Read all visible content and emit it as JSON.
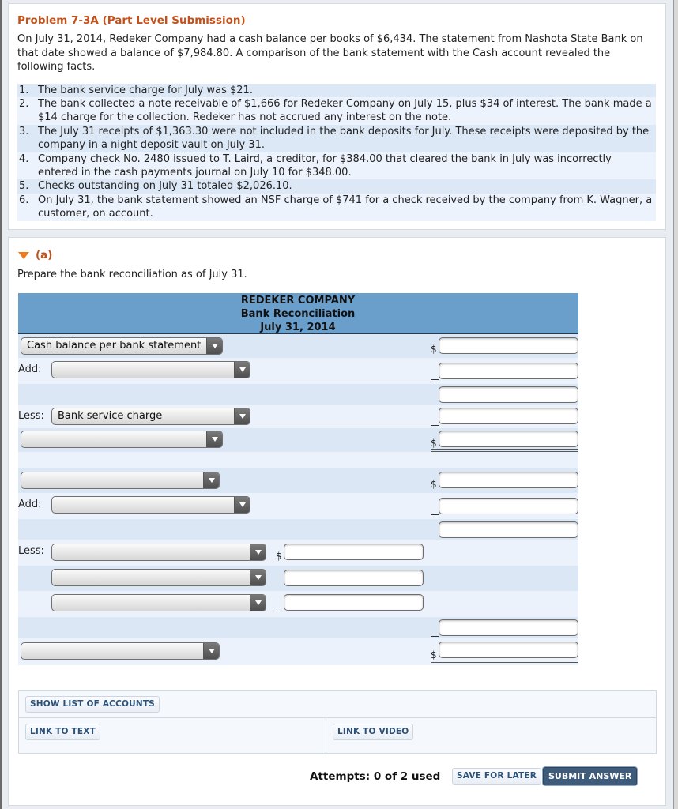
{
  "problem": {
    "title": "Problem 7-3A (Part Level Submission)",
    "intro": "On July 31, 2014, Redeker Company had a cash balance per books of $6,434. The statement from Nashota State Bank on that date showed a balance of $7,984.80. A comparison of the bank statement with the Cash account revealed the following facts.",
    "facts": [
      {
        "num": "1.",
        "text": "The bank service charge for July was $21."
      },
      {
        "num": "2.",
        "text": "The bank collected a note receivable of $1,666 for Redeker Company on July 15, plus $34 of interest. The bank made a $14 charge for the collection. Redeker has not accrued any interest on the note."
      },
      {
        "num": "3.",
        "text": "The July 31 receipts of $1,363.30 were not included in the bank deposits for July. These receipts were deposited by the company in a night deposit vault on July 31."
      },
      {
        "num": "4.",
        "text": "Company check No. 2480 issued to T. Laird, a creditor, for $384.00 that cleared the bank in July was incorrectly entered in the cash payments journal on July 10 for $348.00."
      },
      {
        "num": "5.",
        "text": "Checks outstanding on July 31 totaled $2,026.10."
      },
      {
        "num": "6.",
        "text": "On July 31, the bank statement showed an NSF charge of $741 for a check received by the company from K. Wagner, a customer, on account."
      }
    ]
  },
  "part_a": {
    "label": "(a)",
    "instruction": "Prepare the bank reconciliation as of July 31.",
    "header": {
      "company": "REDEKER COMPANY",
      "statement": "Bank Reconciliation",
      "date": "July 31, 2014"
    },
    "labels": {
      "add": "Add:",
      "less": "Less:",
      "dollar": "$"
    },
    "selects": {
      "bank_start": "Cash balance per bank statement",
      "bank_add_1": "",
      "bank_less_1": "Bank service charge",
      "bank_total": "",
      "books_start": "",
      "books_add_1": "",
      "books_less_1": "",
      "books_less_2": "",
      "books_less_3": "",
      "books_total": ""
    },
    "inputs": {
      "bank_start": "",
      "bank_add_1": "",
      "bank_add_2": "",
      "bank_less_1": "",
      "bank_total": "",
      "books_start": "",
      "books_add_1": "",
      "books_add_2": "",
      "books_less_1": "",
      "books_less_2": "",
      "books_less_3": "",
      "books_less_total": "",
      "books_total": ""
    }
  },
  "buttons": {
    "show_accounts": "SHOW LIST OF ACCOUNTS",
    "link_text": "LINK TO TEXT",
    "link_video": "LINK TO VIDEO",
    "save_later": "SAVE FOR LATER",
    "submit": "SUBMIT ANSWER"
  },
  "attempts": "Attempts: 0 of 2 used"
}
